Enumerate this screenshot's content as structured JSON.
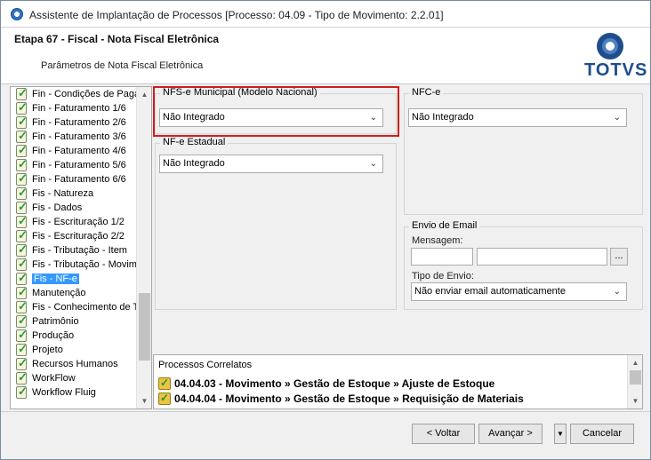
{
  "window": {
    "title": "Assistente de Implantação de Processos [Processo: 04.09 - Tipo de Movimento: 2.2.01]"
  },
  "header": {
    "step_title": "Etapa 67 - Fiscal - Nota Fiscal Eletrônica",
    "step_subtitle": "Parâmetros de Nota Fiscal Eletrônica",
    "logo_text": "TOTVS"
  },
  "sidebar": {
    "items": [
      {
        "label": "Fin - Condições de Paga"
      },
      {
        "label": "Fin - Faturamento 1/6"
      },
      {
        "label": "Fin - Faturamento 2/6"
      },
      {
        "label": "Fin - Faturamento 3/6"
      },
      {
        "label": "Fin - Faturamento 4/6"
      },
      {
        "label": "Fin - Faturamento 5/6"
      },
      {
        "label": "Fin - Faturamento 6/6"
      },
      {
        "label": "Fis - Natureza"
      },
      {
        "label": "Fis - Dados"
      },
      {
        "label": "Fis - Escrituração 1/2"
      },
      {
        "label": "Fis - Escrituração 2/2"
      },
      {
        "label": "Fis - Tributação - Item"
      },
      {
        "label": "Fis - Tributação - Movime"
      },
      {
        "label": "Fis - NF-e"
      },
      {
        "label": "Manutenção"
      },
      {
        "label": "Fis - Conhecimento de T"
      },
      {
        "label": "Patrimônio"
      },
      {
        "label": "Produção"
      },
      {
        "label": "Projeto"
      },
      {
        "label": "Recursos Humanos"
      },
      {
        "label": "WorkFlow"
      },
      {
        "label": "Workflow Fluig"
      }
    ],
    "selected_label": "Fis - NF-e"
  },
  "nfse": {
    "title": "NFS-e Municipal (Modelo Nacional)",
    "value": "Não Integrado"
  },
  "nfe_estadual": {
    "title": "NF-e Estadual",
    "value": "Não Integrado"
  },
  "nfce": {
    "title": "NFC-e",
    "value": "Não Integrado"
  },
  "email": {
    "title": "Envio de Email",
    "message_label": "Mensagem:",
    "browse_label": "...",
    "send_type_label": "Tipo de Envio:",
    "send_type_value": "Não enviar email automaticamente"
  },
  "correlatos": {
    "title": "Processos Correlatos",
    "items": [
      {
        "label": "04.04.03 - Movimento » Gestão de Estoque » Ajuste de Estoque"
      },
      {
        "label": "04.04.04 - Movimento » Gestão de Estoque » Requisição de Materiais"
      }
    ]
  },
  "footer": {
    "back_label": "< Voltar",
    "next_label": "Avançar >",
    "cancel_label": "Cancelar"
  },
  "colors": {
    "highlight": "#d21c1c",
    "selection": "#3399ff",
    "brand": "#1f4e8c"
  }
}
